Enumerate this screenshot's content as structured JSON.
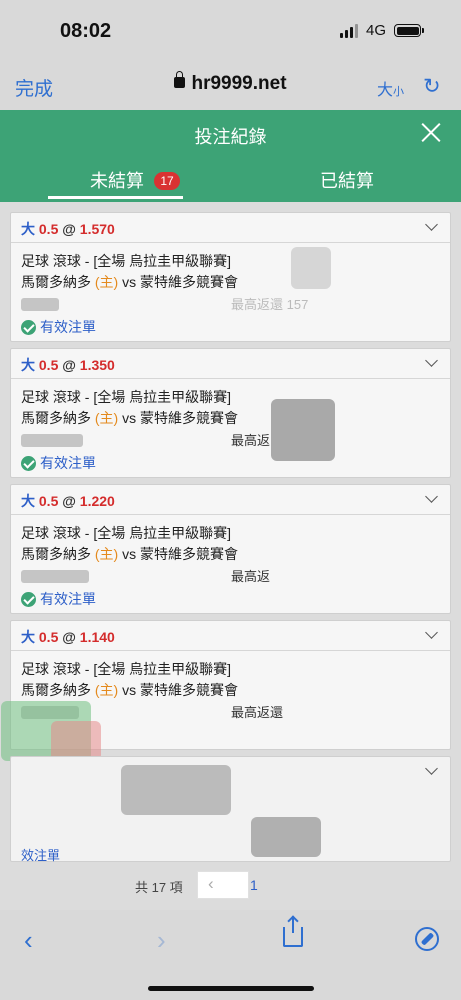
{
  "status_bar": {
    "time": "08:02",
    "network": "4G"
  },
  "browser": {
    "done": "完成",
    "url": "hr9999.net",
    "text_size_big": "大",
    "text_size_small": "小"
  },
  "header": {
    "title": "投注紀錄"
  },
  "tabs": {
    "unsettled": "未結算",
    "unsettled_count": "17",
    "settled": "已結算"
  },
  "bets": [
    {
      "bet_type": "大",
      "handicap": "0.5",
      "at": "@",
      "odds": "1.570",
      "sport_line": "足球 滾球 - [全場 烏拉圭甲級聯賽]",
      "home": "馬爾多納多",
      "home_tag": "(主)",
      "vs": "vs",
      "away": "蒙特維多競賽會",
      "max_return": "最高返還 157",
      "status": "有效注單"
    },
    {
      "bet_type": "大",
      "handicap": "0.5",
      "at": "@",
      "odds": "1.350",
      "sport_line": "足球 滾球 - [全場 烏拉圭甲級聯賽]",
      "home": "馬爾多納多",
      "home_tag": "(主)",
      "vs": "vs",
      "away": "蒙特維多競賽會",
      "max_return": "最高返",
      "status": "有效注單"
    },
    {
      "bet_type": "大",
      "handicap": "0.5",
      "at": "@",
      "odds": "1.220",
      "sport_line": "足球 滾球 - [全場 烏拉圭甲級聯賽]",
      "home": "馬爾多納多",
      "home_tag": "(主)",
      "vs": "vs",
      "away": "蒙特維多競賽會",
      "max_return": "最高返",
      "status": "有效注單"
    },
    {
      "bet_type": "大",
      "handicap": "0.5",
      "at": "@",
      "odds": "1.140",
      "sport_line": "足球 滾球 - [全場 烏拉圭甲級聯賽]",
      "home": "馬爾多納多",
      "home_tag": "(主)",
      "vs": "vs",
      "away": "蒙特維多競賽會",
      "max_return": "最高返還",
      "status": ""
    },
    {
      "bet_type": "",
      "handicap": "",
      "at": "",
      "odds": "",
      "sport_line": "",
      "home": "",
      "home_tag": "",
      "vs": "",
      "away": "",
      "max_return": "",
      "status": "效注單"
    }
  ],
  "pagination": {
    "total": "共 17 項",
    "prev": "‹",
    "current_page": "1"
  },
  "colors": {
    "header_green": "#3da376",
    "link_blue": "#2d5fc8",
    "odds_red": "#d42c2c",
    "home_orange": "#e48a1e",
    "badge_red": "#d93232"
  }
}
